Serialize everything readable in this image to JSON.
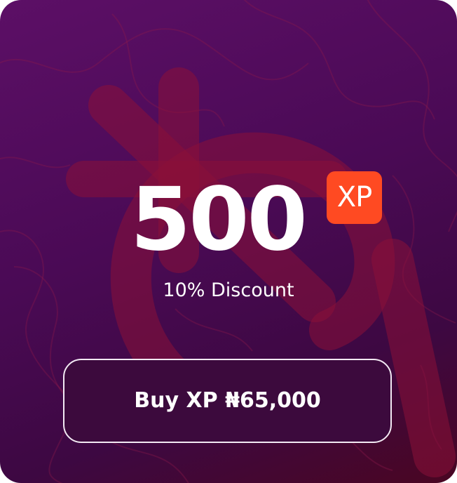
{
  "card": {
    "amount": "500",
    "unit_badge": "XP",
    "discount": "10% Discount",
    "buy_label": "Buy XP ₦65,000",
    "background_icon": "naira-symbol-icon",
    "colors": {
      "background_start": "#5c0f66",
      "background_end": "#3d0842",
      "badge": "#ff4a22",
      "watermark": "#8a1038",
      "text": "#ffffff"
    }
  }
}
